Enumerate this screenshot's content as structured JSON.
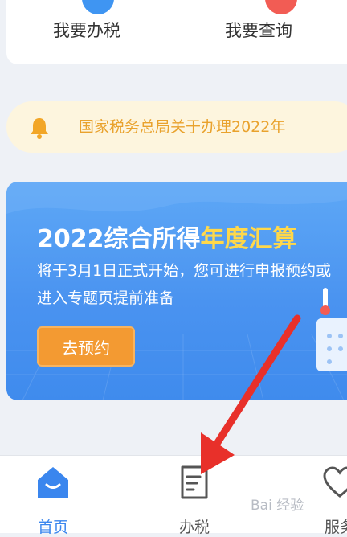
{
  "quick_actions": {
    "left_label": "我要办税",
    "right_label": "我要查询"
  },
  "notice": {
    "text": "国家税务总局关于办理2022年"
  },
  "banner": {
    "title_prefix": "2022综合所得",
    "title_highlight": "年度汇算",
    "subtitle": "将于3月1日正式开始，您可进行申报预约或进入专题页提前准备",
    "cta_label": "去预约"
  },
  "tabbar": {
    "items": [
      {
        "label": "首页",
        "icon": "home-icon",
        "active": true
      },
      {
        "label": "办税",
        "icon": "tax-form-icon",
        "active": false
      },
      {
        "label": "服务",
        "icon": "service-heart-icon",
        "active": false
      }
    ]
  },
  "watermark": "Bai 经验",
  "colors": {
    "accent_blue": "#3a86ee",
    "notice_text": "#e9a22d",
    "cta_orange": "#f39a32",
    "annotation_arrow": "#e8302a",
    "title_highlight": "#ffd84a"
  }
}
